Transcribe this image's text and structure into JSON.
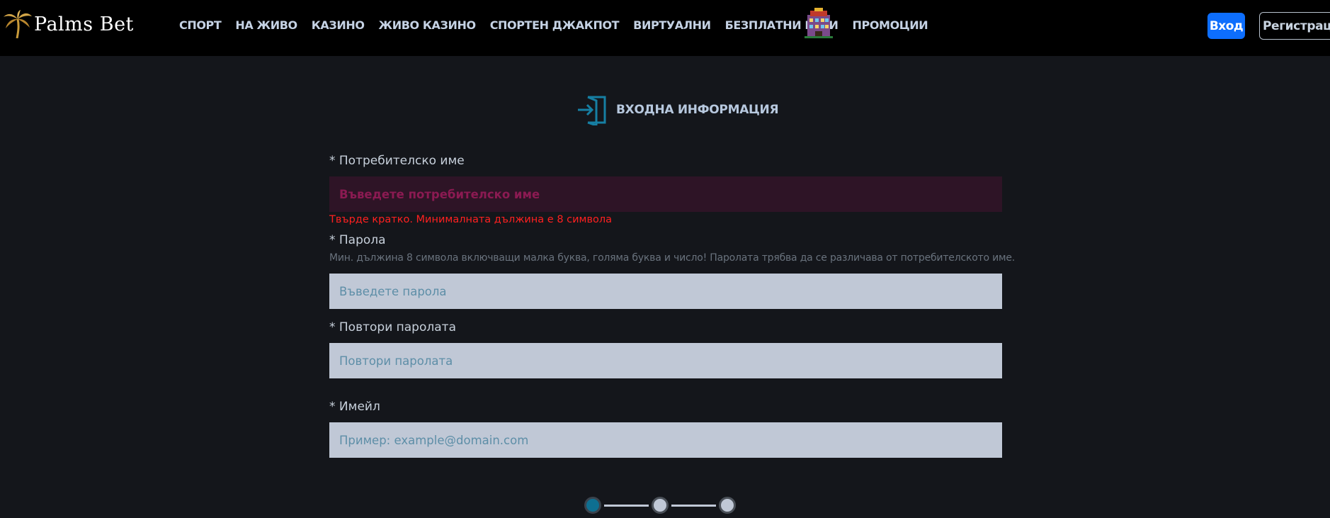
{
  "header": {
    "logo_text": "Palms Bet",
    "nav": [
      {
        "label": "СПОРТ"
      },
      {
        "label": "НА ЖИВО"
      },
      {
        "label": "КАЗИНО"
      },
      {
        "label": "ЖИВО КАЗИНО"
      },
      {
        "label": "СПОРТЕН ДЖАКПОТ"
      },
      {
        "label": "ВИРТУАЛНИ"
      },
      {
        "label": "БЕЗПЛАТНИ ИГРИ"
      },
      {
        "label": "ПРОМОЦИИ"
      }
    ],
    "login_label": "Вход",
    "register_label": "Регистрация"
  },
  "form": {
    "section_title": "ВХОДНА ИНФОРМАЦИЯ",
    "username": {
      "label": "* Потребителско име",
      "placeholder": "Въведете потребителско име",
      "value": "",
      "error": "Твърде кратко. Минималната дължина е 8 символа"
    },
    "password": {
      "label": "* Парола",
      "hint": "Мин. дължина 8 символа включващи малка буква, голяма буква и число! Паролата трябва да се различава от потребителското име.",
      "placeholder": "Въведете парола",
      "value": ""
    },
    "repeat_password": {
      "label": "* Повтори паролата",
      "placeholder": "Повтори паролата",
      "value": ""
    },
    "email": {
      "label": "* Имейл",
      "placeholder": "Пример: example@domain.com",
      "value": ""
    }
  },
  "stepper": {
    "total_steps": 3,
    "current_step": 1
  },
  "colors": {
    "background": "#14161b",
    "header": "#000000",
    "accent_blue": "#0d6efd",
    "icon_teal": "#167fa3",
    "error_red": "#ff2020",
    "input_bg": "#c0c8d6"
  }
}
